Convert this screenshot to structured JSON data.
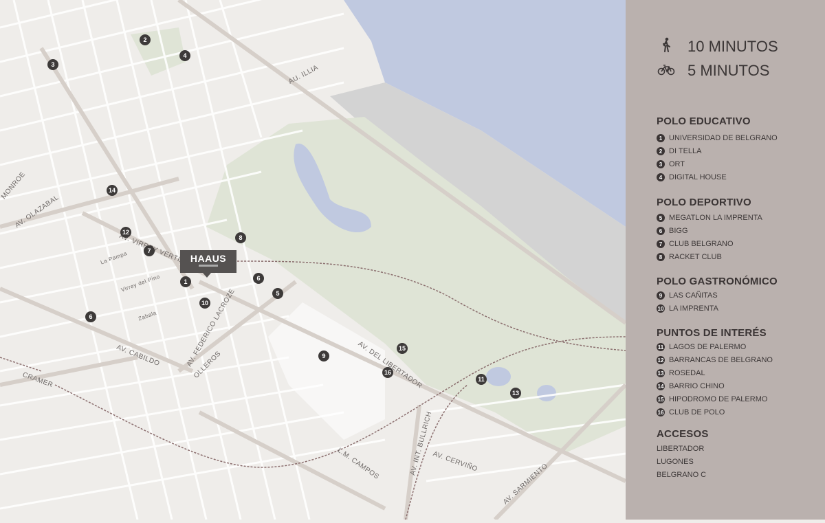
{
  "brand": {
    "name": "HAAUS"
  },
  "travel": [
    {
      "icon": "walking-person-icon",
      "label": "10 MINUTOS"
    },
    {
      "icon": "bicycle-icon",
      "label": "5 MINUTOS"
    }
  ],
  "sections": [
    {
      "title": "POLO EDUCATIVO",
      "items": [
        {
          "n": "1",
          "label": "UNIVERSIDAD DE BELGRANO"
        },
        {
          "n": "2",
          "label": "DI TELLA"
        },
        {
          "n": "3",
          "label": "ORT"
        },
        {
          "n": "4",
          "label": "DIGITAL HOUSE"
        }
      ]
    },
    {
      "title": "POLO DEPORTIVO",
      "items": [
        {
          "n": "5",
          "label": "MEGATLON LA IMPRENTA"
        },
        {
          "n": "6",
          "label": "BIGG"
        },
        {
          "n": "7",
          "label": "CLUB BELGRANO"
        },
        {
          "n": "8",
          "label": "RACKET CLUB"
        }
      ]
    },
    {
      "title": "POLO GASTRONÓMICO",
      "items": [
        {
          "n": "9",
          "label": "LAS CAÑITAS"
        },
        {
          "n": "10",
          "label": "LA IMPRENTA"
        }
      ]
    },
    {
      "title": "PUNTOS DE INTERÉS",
      "items": [
        {
          "n": "11",
          "label": "LAGOS DE PALERMO"
        },
        {
          "n": "12",
          "label": "BARRANCAS DE BELGRANO"
        },
        {
          "n": "13",
          "label": "ROSEDAL"
        },
        {
          "n": "14",
          "label": "BARRIO CHINO"
        },
        {
          "n": "15",
          "label": "HIPODROMO DE PALERMO"
        },
        {
          "n": "16",
          "label": "CLUB DE POLO"
        }
      ]
    }
  ],
  "accesos": {
    "title": "ACCESOS",
    "items": [
      "LIBERTADOR",
      "LUGONES",
      "BELGRANO C"
    ]
  },
  "map_markers": [
    "2",
    "4",
    "3",
    "14",
    "12",
    "7",
    "8",
    "1",
    "6",
    "5",
    "10",
    "6",
    "15",
    "9",
    "16",
    "11",
    "13"
  ],
  "street_labels": [
    "AU. ILLIA",
    "AV. VIRREY VERTIZ",
    "AV. OLAZABAL",
    "MONROE",
    "AV. FEDERICO LACROZE",
    "OLLEROS",
    "AV. CABILDO",
    "CRAMER",
    "AV. DEL LIBERTADOR",
    "L.M. CAMPOS",
    "AV. INT. BULLRICH",
    "AV. CERVIÑO",
    "AV. SARMIENTO",
    "La Pampa",
    "Virrey del Pino",
    "Zabala"
  ],
  "colors": {
    "water": "#c0c9e0",
    "park": "#dfe4d6",
    "land": "#efedea",
    "sidebar": "#bab1ae"
  }
}
